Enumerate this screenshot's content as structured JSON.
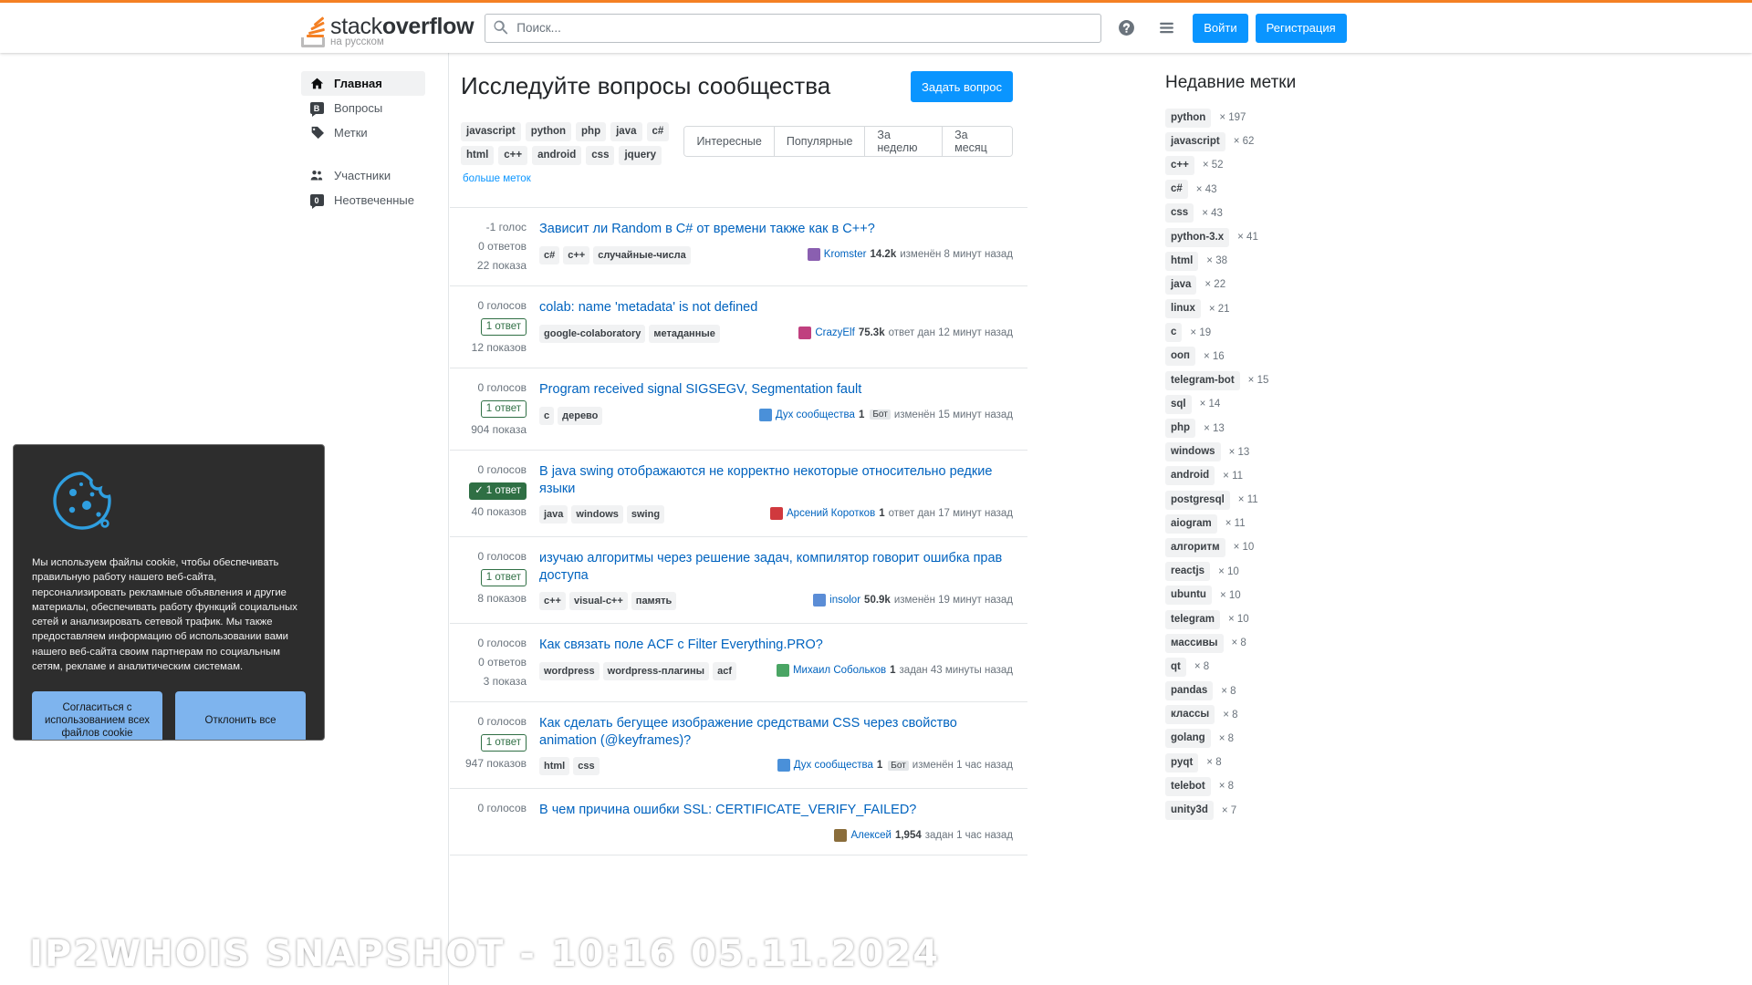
{
  "topbar": {
    "logo_text_light": "stack",
    "logo_text_bold": "overflow",
    "logo_sub": "на русском",
    "search_placeholder": "Поиск...",
    "help_icon": "help-circle-icon",
    "stacks_icon": "hamburger-stacks-icon",
    "login_label": "Войти",
    "signup_label": "Регистрация"
  },
  "sidebar": {
    "items": [
      {
        "label": "Главная",
        "icon": "home-icon",
        "active": true
      },
      {
        "label": "Вопросы",
        "icon": "question-bubble-icon",
        "active": false
      },
      {
        "label": "Метки",
        "icon": "tag-icon",
        "active": false
      },
      {
        "label": "Участники",
        "icon": "users-icon",
        "active": false
      },
      {
        "label": "Неотвеченные",
        "icon": "unanswered-bubble-icon",
        "active": false
      }
    ]
  },
  "main": {
    "title": "Исследуйте вопросы сообщества",
    "ask_button": "Задать вопрос",
    "tags": [
      "javascript",
      "python",
      "php",
      "java",
      "c#",
      "html",
      "c++",
      "android",
      "css",
      "jquery"
    ],
    "more_tags": "больше меток",
    "tabs": [
      "Интересные",
      "Популярные",
      "За неделю",
      "За месяц"
    ],
    "questions": [
      {
        "votes": "-1 голос",
        "answers": "0 ответов",
        "answers_style": "plain",
        "views": "22 показа",
        "title": "Зависит ли Random в C# от времени также как в C++?",
        "tags": [
          "c#",
          "c++",
          "случайные-числа"
        ],
        "avatar_color": "#8a5fb0",
        "user": "Kromster",
        "rep": "14.2k",
        "bot": "",
        "action": "изменён 8 минут назад"
      },
      {
        "votes": "0 голосов",
        "answers": "1 ответ",
        "answers_style": "outline",
        "views": "12 показов",
        "title": "colab: name 'metadata' is not defined",
        "tags": [
          "google-colaboratory",
          "метаданные"
        ],
        "avatar_color": "#c0407f",
        "user": "CrazyElf",
        "rep": "75.3k",
        "bot": "",
        "action": "ответ дан 12 минут назад"
      },
      {
        "votes": "0 голосов",
        "answers": "1 ответ",
        "answers_style": "outline",
        "views": "904 показа",
        "title": "Program received signal SIGSEGV, Segmentation fault",
        "tags": [
          "c",
          "дерево"
        ],
        "avatar_color": "#4a90d9",
        "user": "Дух сообщества",
        "rep": "1",
        "bot": "Бот",
        "action": "изменён 15 минут назад"
      },
      {
        "votes": "0 голосов",
        "answers": "1 ответ",
        "answers_style": "solid",
        "views": "40 показов",
        "title": "В java swing отображаются не корректно некоторые относительно редкие языки",
        "tags": [
          "java",
          "windows",
          "swing"
        ],
        "avatar_color": "#d0393e",
        "user": "Арсений Коротков",
        "rep": "1",
        "bot": "",
        "action": "ответ дан 17 минут назад"
      },
      {
        "votes": "0 голосов",
        "answers": "1 ответ",
        "answers_style": "outline",
        "views": "8 показов",
        "title": "изучаю алгоритмы через решение задач, компилятор говорит ошибка прав доступа",
        "tags": [
          "c++",
          "visual-c++",
          "память"
        ],
        "avatar_color": "#5b8dd6",
        "user": "insolor",
        "rep": "50.9k",
        "bot": "",
        "action": "изменён 19 минут назад"
      },
      {
        "votes": "0 голосов",
        "answers": "0 ответов",
        "answers_style": "plain",
        "views": "3 показа",
        "title": "Как связать поле ACF с Filter Everything.PRO?",
        "tags": [
          "wordpress",
          "wordpress-плагины",
          "acf"
        ],
        "avatar_color": "#4aa564",
        "user": "Михаил Собольков",
        "rep": "1",
        "bot": "",
        "action": "задан 43 минуты назад"
      },
      {
        "votes": "0 голосов",
        "answers": "1 ответ",
        "answers_style": "outline",
        "views": "947 показов",
        "title": "Как сделать бегущее изображение средствами CSS через свойство animation (@keyframes)?",
        "tags": [
          "html",
          "css"
        ],
        "avatar_color": "#4a90d9",
        "user": "Дух сообщества",
        "rep": "1",
        "bot": "Бот",
        "action": "изменён 1 час назад"
      },
      {
        "votes": "0 голосов",
        "answers": "",
        "answers_style": "none",
        "views": "",
        "title": "В чем причина ошибки SSL: CERTIFICATE_VERIFY_FAILED?",
        "tags": [],
        "avatar_color": "#8a6d3b",
        "user": "Алексей",
        "rep": "1,954",
        "bot": "",
        "action": "задан 1 час назад"
      }
    ]
  },
  "rightbar": {
    "title": "Недавние метки",
    "tags": [
      {
        "name": "python",
        "count": "× 197"
      },
      {
        "name": "javascript",
        "count": "× 62"
      },
      {
        "name": "c++",
        "count": "× 52"
      },
      {
        "name": "c#",
        "count": "× 43"
      },
      {
        "name": "css",
        "count": "× 43"
      },
      {
        "name": "python-3.x",
        "count": "× 41"
      },
      {
        "name": "html",
        "count": "× 38"
      },
      {
        "name": "java",
        "count": "× 22"
      },
      {
        "name": "linux",
        "count": "× 21"
      },
      {
        "name": "c",
        "count": "× 19"
      },
      {
        "name": "ооп",
        "count": "× 16"
      },
      {
        "name": "telegram-bot",
        "count": "× 15"
      },
      {
        "name": "sql",
        "count": "× 14"
      },
      {
        "name": "php",
        "count": "× 13"
      },
      {
        "name": "windows",
        "count": "× 13"
      },
      {
        "name": "android",
        "count": "× 11"
      },
      {
        "name": "postgresql",
        "count": "× 11"
      },
      {
        "name": "aiogram",
        "count": "× 11"
      },
      {
        "name": "алгоритм",
        "count": "× 10"
      },
      {
        "name": "reactjs",
        "count": "× 10"
      },
      {
        "name": "ubuntu",
        "count": "× 10"
      },
      {
        "name": "telegram",
        "count": "× 10"
      },
      {
        "name": "массивы",
        "count": "× 8"
      },
      {
        "name": "qt",
        "count": "× 8"
      },
      {
        "name": "pandas",
        "count": "× 8"
      },
      {
        "name": "классы",
        "count": "× 8"
      },
      {
        "name": "golang",
        "count": "× 8"
      },
      {
        "name": "pyqt",
        "count": "× 8"
      },
      {
        "name": "telebot",
        "count": "× 8"
      },
      {
        "name": "unity3d",
        "count": "× 7"
      }
    ]
  },
  "cookie": {
    "icon": "cookie-icon",
    "text": "Мы используем файлы cookie, чтобы обеспечивать правильную работу нашего веб-сайта, персонализировать рекламные объявления и другие материалы, обеспечивать работу функций социальных сетей и анализировать сетевой трафик. Мы также предоставляем информацию об использовании вами нашего веб-сайта своим партнерам по социальным сетям, рекламе и аналитическим системам.",
    "accept_label": "Согласиться с использованием всех файлов cookie",
    "decline_label": "Отклонить все"
  },
  "watermark": {
    "text": "IP2WHOIS SNAPSHOT - 10:16 05.11.2024"
  },
  "colors": {
    "accent_orange": "#f48024",
    "link_blue": "#0063bf",
    "button_blue": "#0a95ff",
    "tag_bg": "#f1f2f3",
    "answered_green": "#2f6f44"
  }
}
